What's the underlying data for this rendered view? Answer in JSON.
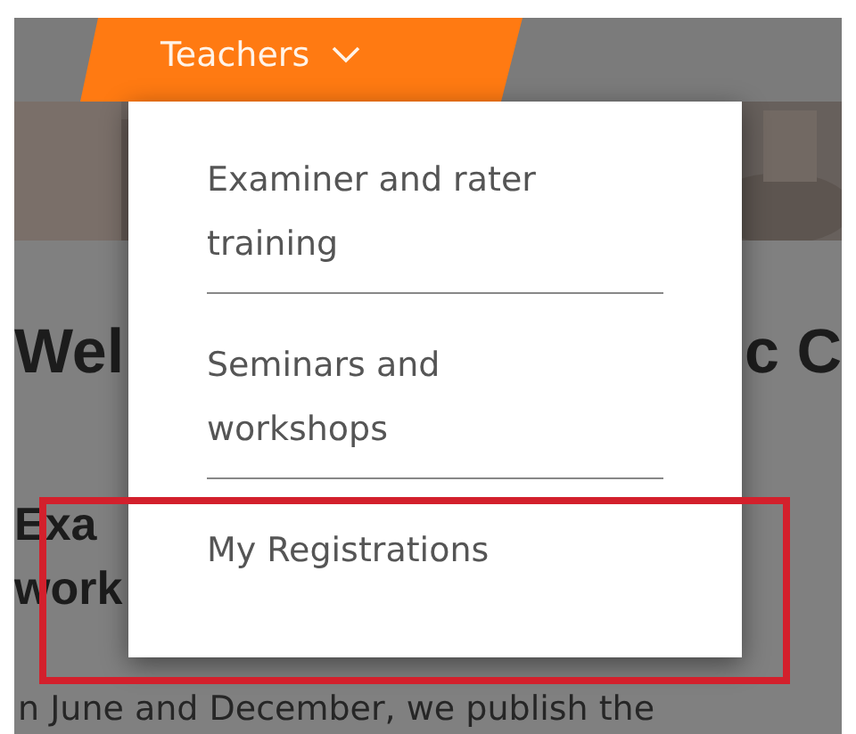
{
  "nav": {
    "tab": {
      "label": "Teachers",
      "expanded": true
    }
  },
  "page": {
    "heading_left": "Wel",
    "heading_right": "c C",
    "subheading_lines": [
      "Exa",
      "work"
    ],
    "paragraph": "n June and December, we publish the"
  },
  "dropdown": {
    "items": [
      {
        "label": "Examiner and rater training",
        "highlighted": false
      },
      {
        "label": "Seminars and workshops",
        "highlighted": false
      },
      {
        "label": "My Registrations",
        "highlighted": true
      }
    ]
  }
}
